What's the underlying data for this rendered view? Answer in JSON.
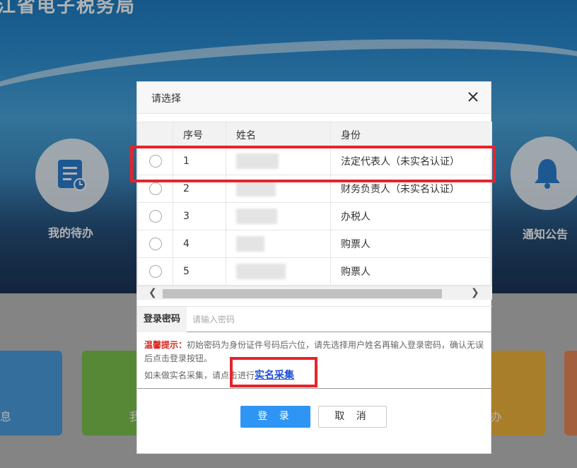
{
  "background": {
    "site_title": "江省电子税务局",
    "left_circle_label": "我的待办",
    "right_circle_label": "通知公告",
    "tile_left_label": "息",
    "tile_green_label": "我",
    "tile_yellow_label": "办"
  },
  "dialog": {
    "title": "请选择",
    "close_icon": "close-icon",
    "columns": [
      "序号",
      "姓名",
      "身份"
    ],
    "rows": [
      {
        "no": "1",
        "role": "法定代表人（未实名认证）"
      },
      {
        "no": "2",
        "role": "财务负责人（未实名认证）"
      },
      {
        "no": "3",
        "role": "办税人"
      },
      {
        "no": "4",
        "role": "购票人"
      },
      {
        "no": "5",
        "role": "购票人"
      }
    ],
    "password_label": "登录密码",
    "password_placeholder": "请输入密码",
    "tip_title": "温馨提示：",
    "tip_text": "初始密码为身份证件号码后六位，请先选择用户姓名再输入登录密码，确认无误后点击登录按钮。",
    "tip2_prefix": "如未做实名采集，请点击进行",
    "tip2_link": "实名采集",
    "login_button": "登 录",
    "cancel_button": "取 消"
  },
  "colors": {
    "accent": "#2e95f4",
    "highlight": "#e8232a",
    "tip_red": "#d9251d",
    "link": "#1e4fd8"
  }
}
